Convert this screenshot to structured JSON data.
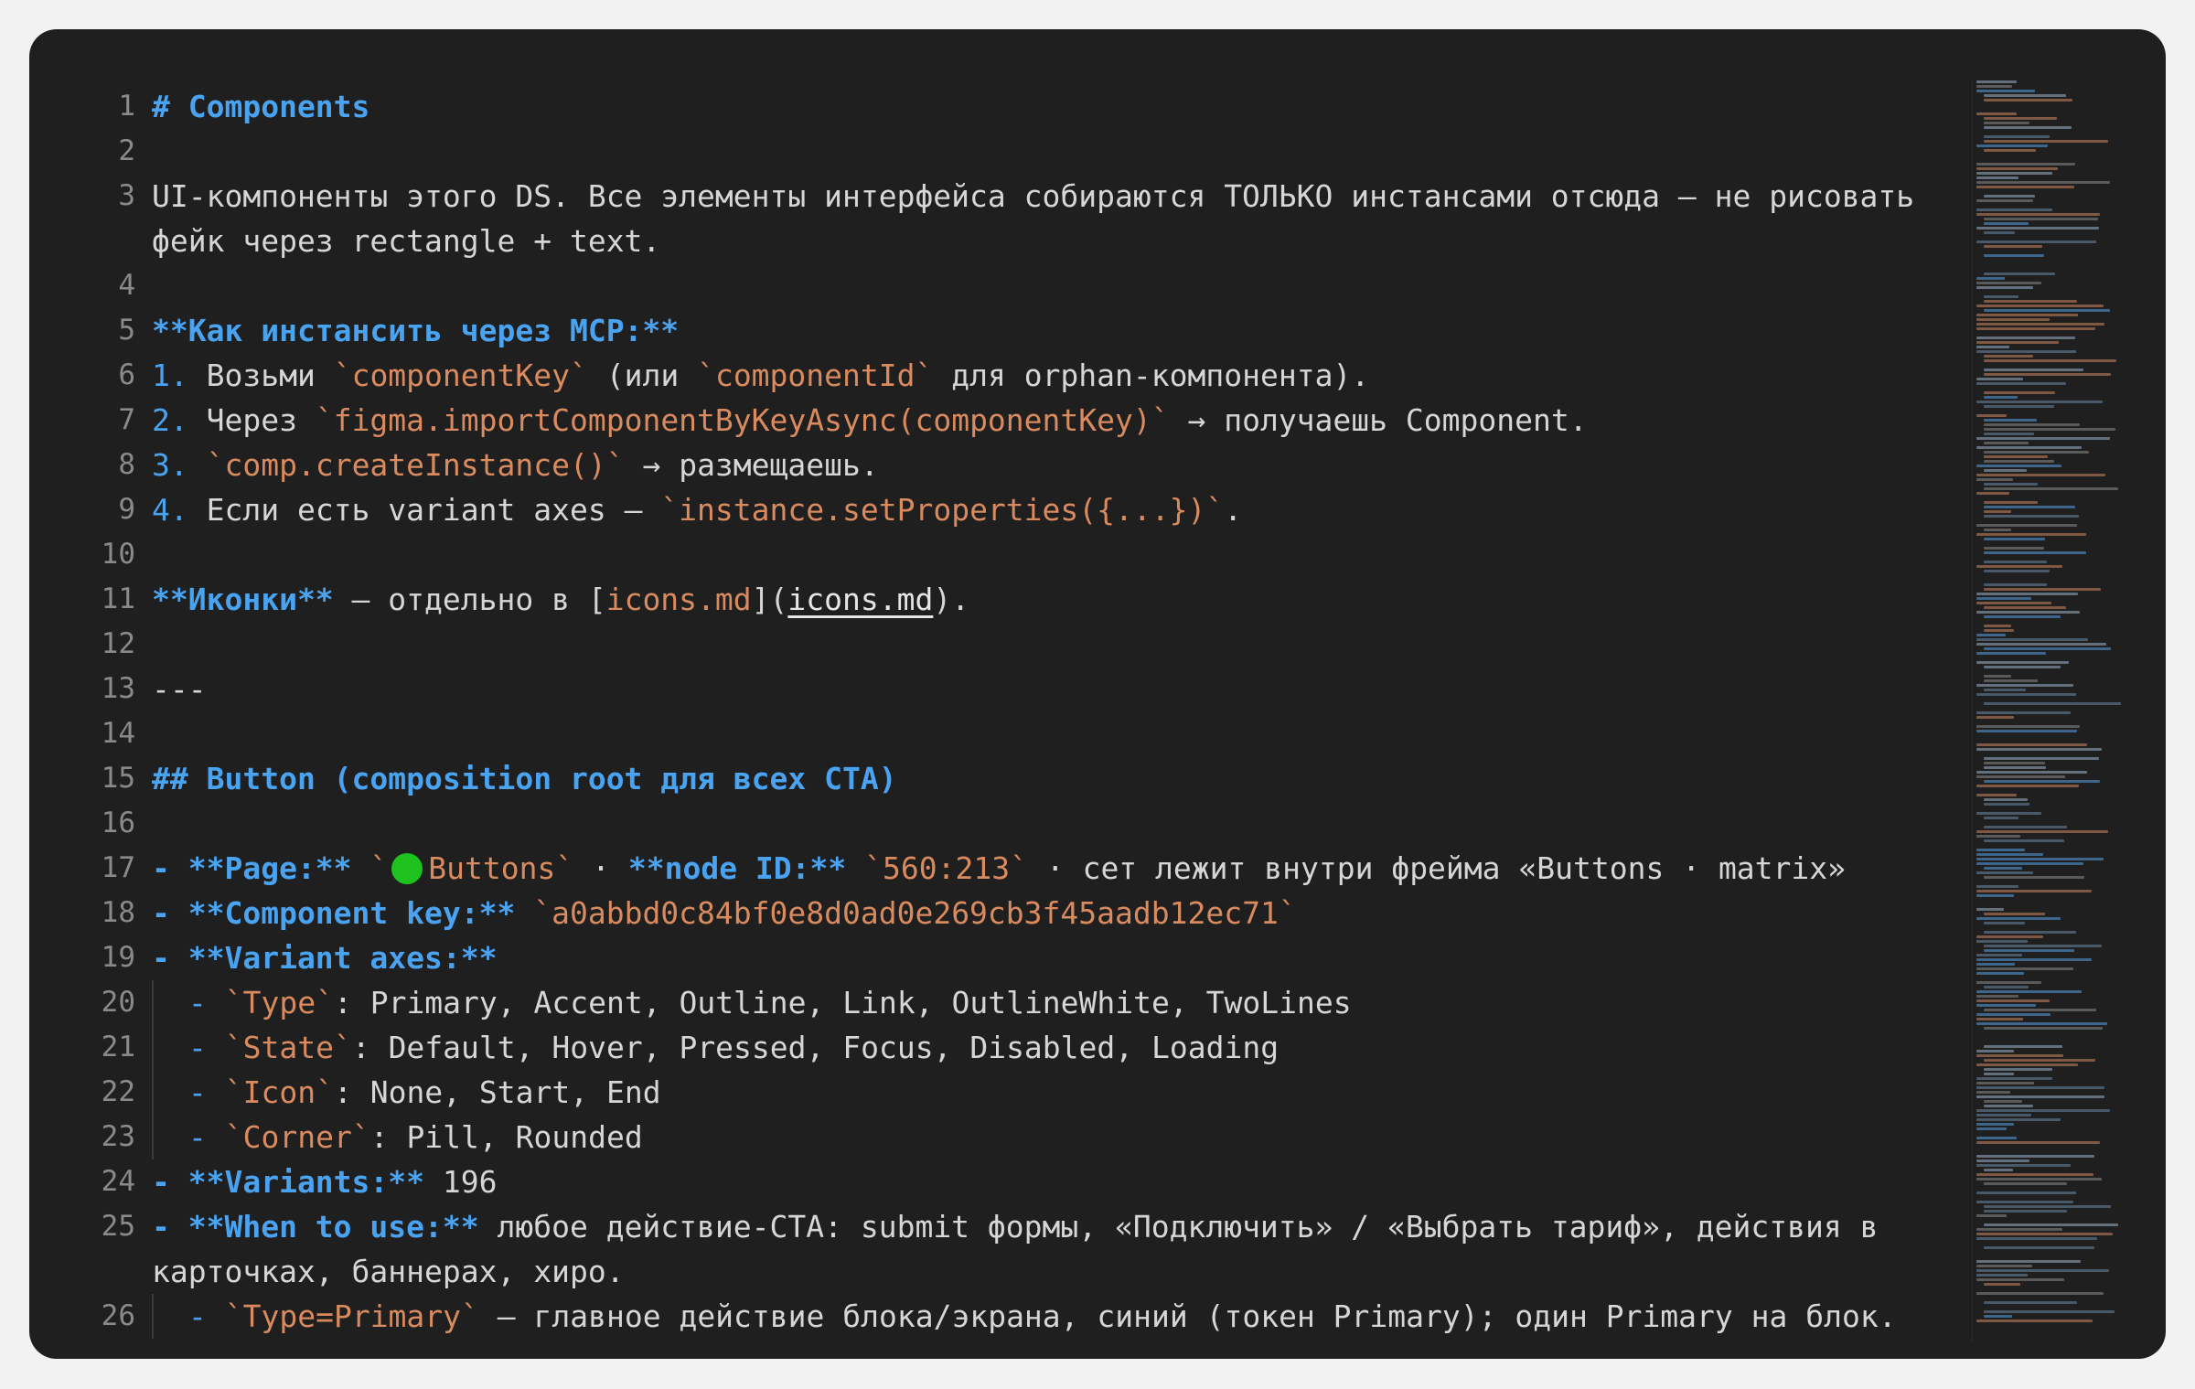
{
  "editor": {
    "lines": [
      {
        "n": "1",
        "segs": [
          {
            "t": "# Components",
            "c": "h"
          }
        ]
      },
      {
        "n": "2",
        "segs": []
      },
      {
        "n": "3",
        "segs": [
          {
            "t": "UI-компоненты этого DS. Все элементы интерфейса собираются ТОЛЬКО инстансами отсюда — не рисовать",
            "c": ""
          }
        ]
      },
      {
        "n": "",
        "segs": [
          {
            "t": "фейк через rectangle + text.",
            "c": ""
          }
        ]
      },
      {
        "n": "4",
        "segs": []
      },
      {
        "n": "5",
        "segs": [
          {
            "t": "**Как инстансить через MCP:**",
            "c": "b"
          }
        ]
      },
      {
        "n": "6",
        "segs": [
          {
            "t": "1.",
            "c": "n"
          },
          {
            "t": " Возьми ",
            "c": ""
          },
          {
            "t": "`componentKey`",
            "c": "c"
          },
          {
            "t": " (или ",
            "c": ""
          },
          {
            "t": "`componentId`",
            "c": "c"
          },
          {
            "t": " для orphan-компонента).",
            "c": ""
          }
        ]
      },
      {
        "n": "7",
        "segs": [
          {
            "t": "2.",
            "c": "n"
          },
          {
            "t": " Через ",
            "c": ""
          },
          {
            "t": "`figma.importComponentByKeyAsync(componentKey)`",
            "c": "c"
          },
          {
            "t": " → получаешь Component.",
            "c": ""
          }
        ]
      },
      {
        "n": "8",
        "segs": [
          {
            "t": "3.",
            "c": "n"
          },
          {
            "t": " ",
            "c": ""
          },
          {
            "t": "`comp.createInstance()`",
            "c": "c"
          },
          {
            "t": " → размещаешь.",
            "c": ""
          }
        ]
      },
      {
        "n": "9",
        "segs": [
          {
            "t": "4.",
            "c": "n"
          },
          {
            "t": " Если есть variant axes — ",
            "c": ""
          },
          {
            "t": "`instance.setProperties({...})`",
            "c": "c"
          },
          {
            "t": ".",
            "c": ""
          }
        ]
      },
      {
        "n": "10",
        "segs": []
      },
      {
        "n": "11",
        "segs": [
          {
            "t": "**Иконки**",
            "c": "b"
          },
          {
            "t": " — отдельно в [",
            "c": ""
          },
          {
            "t": "icons.md",
            "c": "lnk"
          },
          {
            "t": "](",
            "c": ""
          },
          {
            "t": "icons.md",
            "c": "u"
          },
          {
            "t": ").",
            "c": ""
          }
        ]
      },
      {
        "n": "12",
        "segs": []
      },
      {
        "n": "13",
        "segs": [
          {
            "t": "---",
            "c": ""
          }
        ]
      },
      {
        "n": "14",
        "segs": []
      },
      {
        "n": "15",
        "segs": [
          {
            "t": "## Button (composition root для всех CTA)",
            "c": "h"
          }
        ]
      },
      {
        "n": "16",
        "segs": []
      },
      {
        "n": "17",
        "segs": [
          {
            "t": "- **Page:**",
            "c": "b"
          },
          {
            "t": " ",
            "c": ""
          },
          {
            "t": "`",
            "c": "c"
          },
          {
            "dot": true
          },
          {
            "t": "Buttons`",
            "c": "c"
          },
          {
            "t": " · ",
            "c": ""
          },
          {
            "t": "**node ID:**",
            "c": "b"
          },
          {
            "t": " ",
            "c": ""
          },
          {
            "t": "`560:213`",
            "c": "c"
          },
          {
            "t": " · сет лежит внутри фрейма «Buttons · matrix»",
            "c": ""
          }
        ]
      },
      {
        "n": "18",
        "segs": [
          {
            "t": "- **Component key:**",
            "c": "b"
          },
          {
            "t": " ",
            "c": ""
          },
          {
            "t": "`a0abbd0c84bf0e8d0ad0e269cb3f45aadb12ec71`",
            "c": "c"
          }
        ]
      },
      {
        "n": "19",
        "segs": [
          {
            "t": "- **Variant axes:**",
            "c": "b"
          }
        ]
      },
      {
        "n": "20",
        "indent": true,
        "segs": [
          {
            "t": "- ",
            "c": "n"
          },
          {
            "t": "`Type`",
            "c": "c"
          },
          {
            "t": ": Primary, Accent, Outline, Link, OutlineWhite, TwoLines",
            "c": ""
          }
        ]
      },
      {
        "n": "21",
        "indent": true,
        "segs": [
          {
            "t": "- ",
            "c": "n"
          },
          {
            "t": "`State`",
            "c": "c"
          },
          {
            "t": ": Default, Hover, Pressed, Focus, Disabled, Loading",
            "c": ""
          }
        ]
      },
      {
        "n": "22",
        "indent": true,
        "segs": [
          {
            "t": "- ",
            "c": "n"
          },
          {
            "t": "`Icon`",
            "c": "c"
          },
          {
            "t": ": None, Start, End",
            "c": ""
          }
        ]
      },
      {
        "n": "23",
        "indent": true,
        "segs": [
          {
            "t": "- ",
            "c": "n"
          },
          {
            "t": "`Corner`",
            "c": "c"
          },
          {
            "t": ": Pill, Rounded",
            "c": ""
          }
        ]
      },
      {
        "n": "24",
        "segs": [
          {
            "t": "- **Variants:**",
            "c": "b"
          },
          {
            "t": " 196",
            "c": ""
          }
        ]
      },
      {
        "n": "25",
        "segs": [
          {
            "t": "- **When to use:**",
            "c": "b"
          },
          {
            "t": " любое действие-CTA: submit формы, «Подключить» / «Выбрать тариф», действия в",
            "c": ""
          }
        ]
      },
      {
        "n": "",
        "segs": [
          {
            "t": "карточках, баннерах, хиро.",
            "c": ""
          }
        ]
      },
      {
        "n": "26",
        "indent": true,
        "segs": [
          {
            "t": "- ",
            "c": "n"
          },
          {
            "t": "`Type=Primary`",
            "c": "c"
          },
          {
            "t": " — главное действие блока/экрана, синий (токен Primary); один Primary на блок.",
            "c": ""
          }
        ]
      }
    ]
  },
  "colors": {
    "background": "#1f1f1f",
    "heading": "#4aa3f0",
    "code": "#d98b5f",
    "text": "#d6d6d6",
    "status_dot": "#1ec21e"
  }
}
